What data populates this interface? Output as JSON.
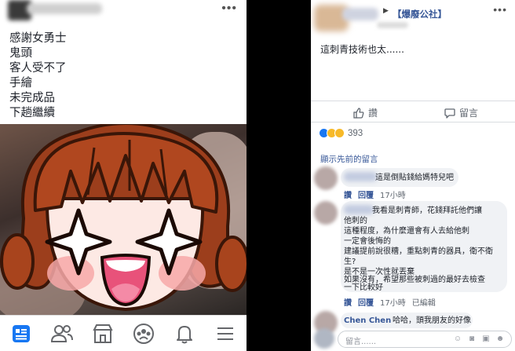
{
  "left_post": {
    "lines": [
      "感謝女勇士",
      "鬼頭",
      "客人受不了",
      "手繪",
      "未完成品",
      "下趟繼續"
    ],
    "more_icon": "more-dots-icon"
  },
  "left_nav": {
    "items": [
      "news-feed-icon",
      "friends-icon",
      "marketplace-icon",
      "groups-icon",
      "notifications-icon",
      "menu-icon"
    ],
    "active": "news-feed-icon",
    "accent": "#1877f2"
  },
  "right_post": {
    "group": "【爆廢公社】",
    "text": "這刺青技術也太......",
    "like_label": "讚",
    "comment_label": "留言",
    "reaction_count": "393",
    "reaction_colors": [
      "#1877f2",
      "#f7b928",
      "#f7b928"
    ],
    "prev_comments": "顯示先前的留言"
  },
  "comments": [
    {
      "lines": [
        "這是倒貼錢給媽特兒吧"
      ],
      "actions": [
        "讚",
        "回覆"
      ],
      "time": "17小時",
      "edited": ""
    },
    {
      "lines": [
        "我看是刺青師，花錢拜託他們讓",
        "他刺的",
        "這種程度，為什麼還會有人去給他刺",
        "一定會後悔的",
        "建議提前說很糟，重點刺青的器具，衛不衛",
        "生?",
        "是不是一次性就丟棄",
        "如果沒有，希望那些被刺過的最好去檢查",
        "一下比較好"
      ],
      "actions": [
        "讚",
        "回覆"
      ],
      "time": "17小時",
      "edited": "已編輯"
    },
    {
      "name": "Chen Chen",
      "lines": [
        "哈哈，頭我朋友的好像"
      ],
      "actions": [],
      "time": "",
      "edited": ""
    }
  ],
  "input": {
    "placeholder": "留言......"
  }
}
